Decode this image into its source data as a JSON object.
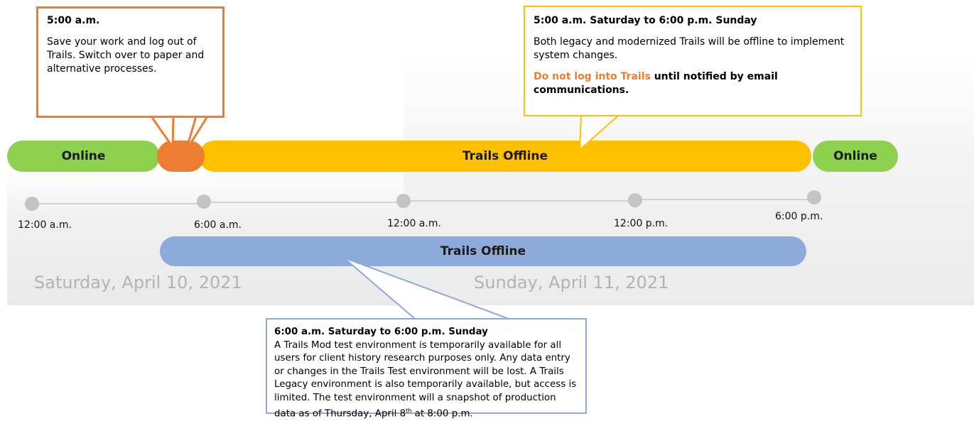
{
  "timeline": {
    "bars": {
      "online_left": "Online",
      "offline_main": "Trails Offline",
      "online_right": "Online",
      "offline_lower": "Trails Offline"
    },
    "ticks": [
      "12:00 a.m.",
      "6:00 a.m.",
      "12:00 a.m.",
      "12:00 p.m.",
      "6:00 p.m."
    ],
    "days": [
      "Saturday, April 10, 2021",
      "Sunday, April 11, 2021"
    ]
  },
  "callouts": {
    "logout": {
      "title": "5:00 a.m.",
      "body": "Save your work and log out of Trails. Switch over to paper and alternative processes."
    },
    "offline": {
      "title": "5:00 a.m. Saturday to 6:00 p.m. Sunday",
      "body": "Both legacy and modernized Trails will be offline to implement system changes.",
      "warning": "Do not log into Trails",
      "warning_rest": " until notified by email communications."
    },
    "test_env": {
      "title": "6:00 a.m. Saturday to 6:00 p.m. Sunday",
      "body_before_sup": "A Trails Mod test environment is temporarily available for all users for client history research purposes only. Any data entry or changes in the Trails Test environment will be lost.  A Trails Legacy environment is also temporarily available, but access is limited. The test environment will a snapshot of production data as of Thursday, April 8",
      "sup": "th",
      "body_after_sup": " at 8:00 p.m."
    }
  },
  "colors": {
    "online": "#8ed14f",
    "offline": "#ffc000",
    "transition": "#ed7d31",
    "test_offline": "#8eaadb"
  }
}
